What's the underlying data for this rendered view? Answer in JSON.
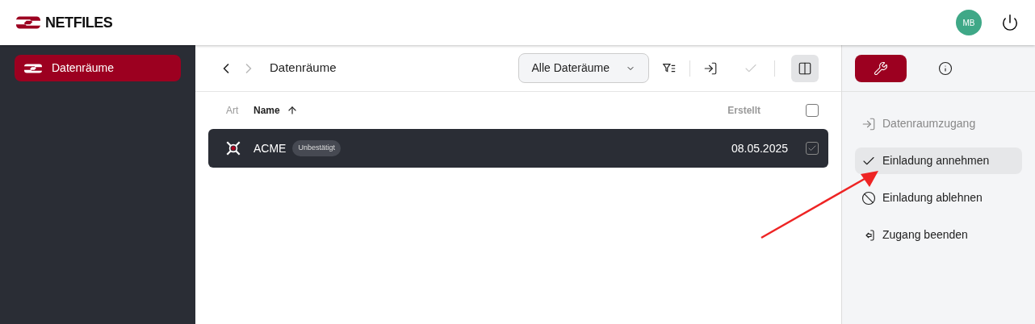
{
  "header": {
    "logo": "NETFILES",
    "avatar": "MB"
  },
  "sidebar": {
    "items": [
      {
        "label": "Datenräume",
        "selected": true
      }
    ]
  },
  "toolbar": {
    "title": "Datenräume",
    "filter": "Alle Dateräume",
    "accept_disabled": true,
    "panel_open": true
  },
  "table": {
    "columns": [
      {
        "label": "Art",
        "sorted": false
      },
      {
        "label": "Name",
        "sorted": true
      },
      {
        "label": "Erstellt",
        "sorted": false
      }
    ],
    "all_checked": false,
    "rows": [
      {
        "name": "ACME",
        "badge": "Unbestätigt",
        "created": "08.05.2025",
        "selected": true,
        "checked": true
      }
    ]
  },
  "panel": {
    "tabs": [
      {
        "kind": "tools",
        "selected": true
      },
      {
        "kind": "info",
        "selected": false
      }
    ],
    "actions": [
      {
        "kind": "enter",
        "label": "Datenraumzugang",
        "disabled": true,
        "selected": false
      },
      {
        "kind": "accept",
        "label": "Einladung annehmen",
        "disabled": false,
        "selected": true
      },
      {
        "kind": "decline",
        "label": "Einladung ablehnen",
        "disabled": false,
        "selected": false
      },
      {
        "kind": "leave",
        "label": "Zugang beenden",
        "disabled": false,
        "selected": false
      }
    ]
  },
  "annotation": {
    "kind": "arrow"
  }
}
